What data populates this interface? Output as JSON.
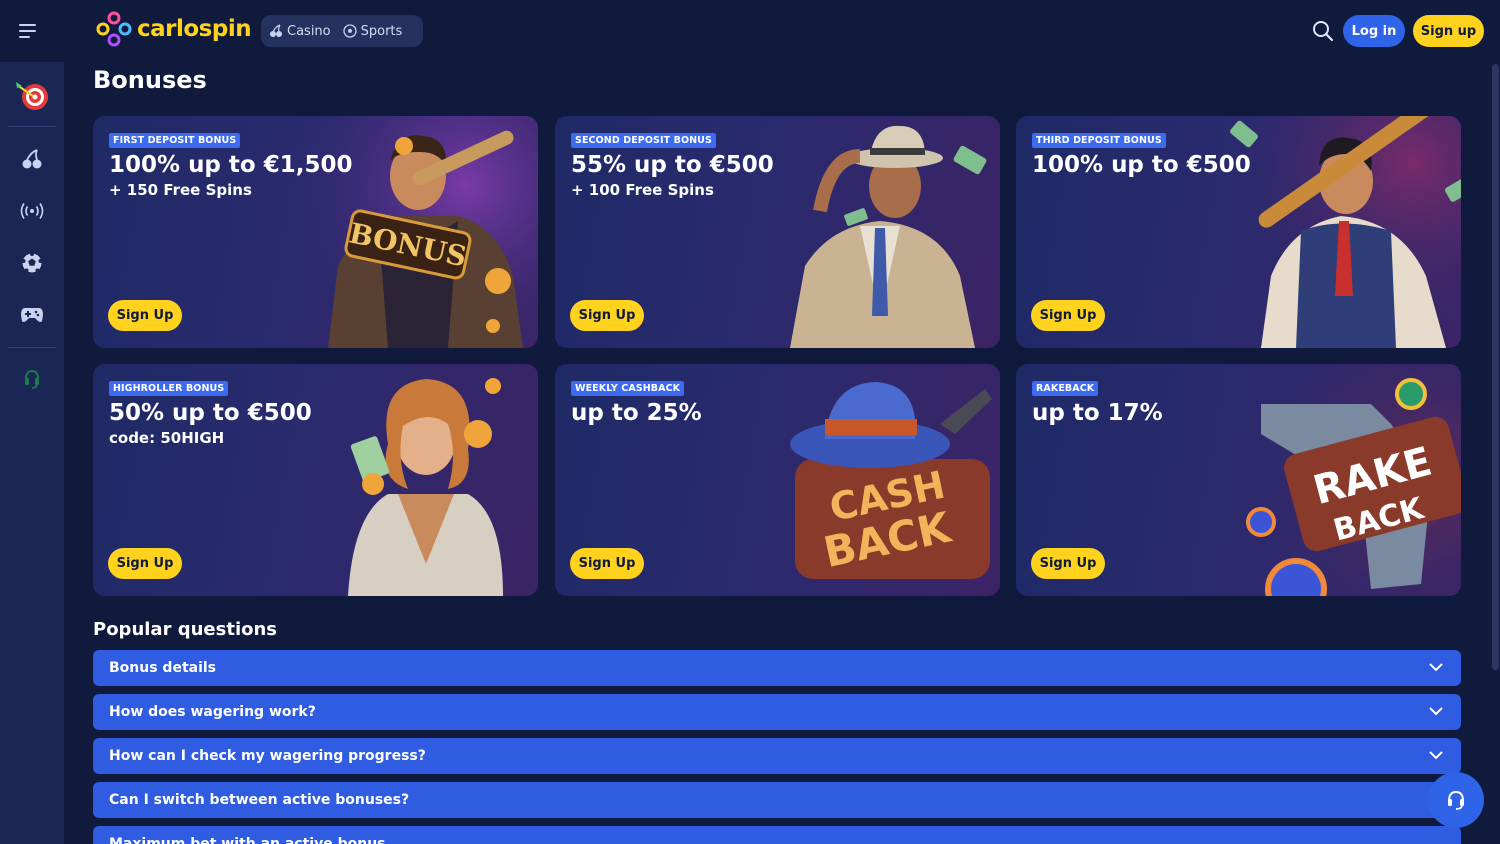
{
  "header": {
    "logo_text": "carlospin",
    "modes": [
      {
        "label": "Casino",
        "icon": "cherry-icon"
      },
      {
        "label": "Sports",
        "icon": "soccer-ball-icon"
      }
    ],
    "login_label": "Log in",
    "signup_label": "Sign up"
  },
  "sidebar": {
    "items": [
      {
        "name": "darts-promo-icon"
      },
      {
        "name": "cherry-icon"
      },
      {
        "name": "live-broadcast-icon"
      },
      {
        "name": "soccer-ball-icon"
      },
      {
        "name": "gamepad-icon"
      },
      {
        "name": "support-headset-icon"
      }
    ]
  },
  "page": {
    "title": "Bonuses"
  },
  "cards": [
    {
      "badge": "FIRST DEPOSIT BONUS",
      "headline": "100% up to €1,500",
      "subline": "+ 150 Free Spins",
      "button": "Sign Up"
    },
    {
      "badge": "SECOND DEPOSIT BONUS",
      "headline": "55% up to €500",
      "subline": "+ 100 Free Spins",
      "button": "Sign Up"
    },
    {
      "badge": "THIRD DEPOSIT BONUS",
      "headline": "100% up to €500",
      "subline": "",
      "button": "Sign Up"
    },
    {
      "badge": "HIGHROLLER BONUS",
      "headline": "50% up to €500",
      "subline": "code: 50HIGH",
      "button": "Sign Up"
    },
    {
      "badge": "WEEKLY CASHBACK",
      "headline": "up to 25%",
      "subline": "",
      "button": "Sign Up"
    },
    {
      "badge": "RAKEBACK",
      "headline": "up to 17%",
      "subline": "",
      "button": "Sign Up",
      "art_text_1": "RAKE",
      "art_text_2": "BACK"
    }
  ],
  "card_art_text": {
    "bonus": "BONUS",
    "cash": "CASH",
    "back": "BACK",
    "rake": "RAKE"
  },
  "faq": {
    "title": "Popular questions",
    "items": [
      "Bonus details",
      "How does wagering work?",
      "How can I check my wagering progress?",
      "Can I switch between active bonuses?",
      "Maximum bet with an active bonus"
    ]
  },
  "colors": {
    "background": "#0f1a3c",
    "accent_yellow": "#ffd21e",
    "accent_blue": "#2f64e8",
    "faq_blue": "#2f5ce0"
  }
}
